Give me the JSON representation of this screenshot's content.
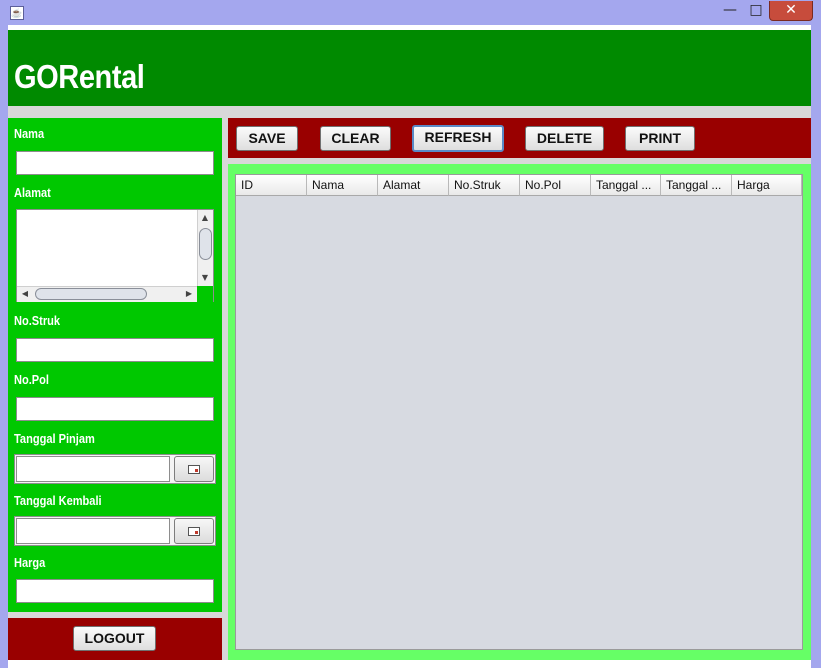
{
  "window": {
    "close_glyph": "✕",
    "maximize_glyph": "□",
    "minimize_glyph": "—",
    "app_icon": "java-icon"
  },
  "header": {
    "title": "GORental"
  },
  "form": {
    "nama_label": "Nama",
    "alamat_label": "Alamat",
    "no_struk_label": "No.Struk",
    "no_pol_label": "No.Pol",
    "tanggal_pinjam_label": "Tanggal Pinjam",
    "tanggal_kembali_label": "Tanggal Kembali",
    "harga_label": "Harga",
    "nama_value": "",
    "alamat_value": "",
    "no_struk_value": "",
    "no_pol_value": "",
    "tanggal_pinjam_value": "",
    "tanggal_kembali_value": "",
    "harga_value": ""
  },
  "toolbar": {
    "save_label": "SAVE",
    "clear_label": "CLEAR",
    "refresh_label": "REFRESH",
    "delete_label": "DELETE",
    "print_label": "PRINT"
  },
  "logout_label": "LOGOUT",
  "table": {
    "columns": [
      "ID",
      "Nama",
      "Alamat",
      "No.Struk",
      "No.Pol",
      "Tanggal ...",
      "Tanggal ...",
      "Harga"
    ],
    "rows": []
  },
  "colors": {
    "header_green": "#008a00",
    "form_green": "#00c800",
    "table_green": "#66ff66",
    "dark_red": "#990000",
    "table_bg": "#d7dae1",
    "title_bar": "#a4a7ee"
  }
}
